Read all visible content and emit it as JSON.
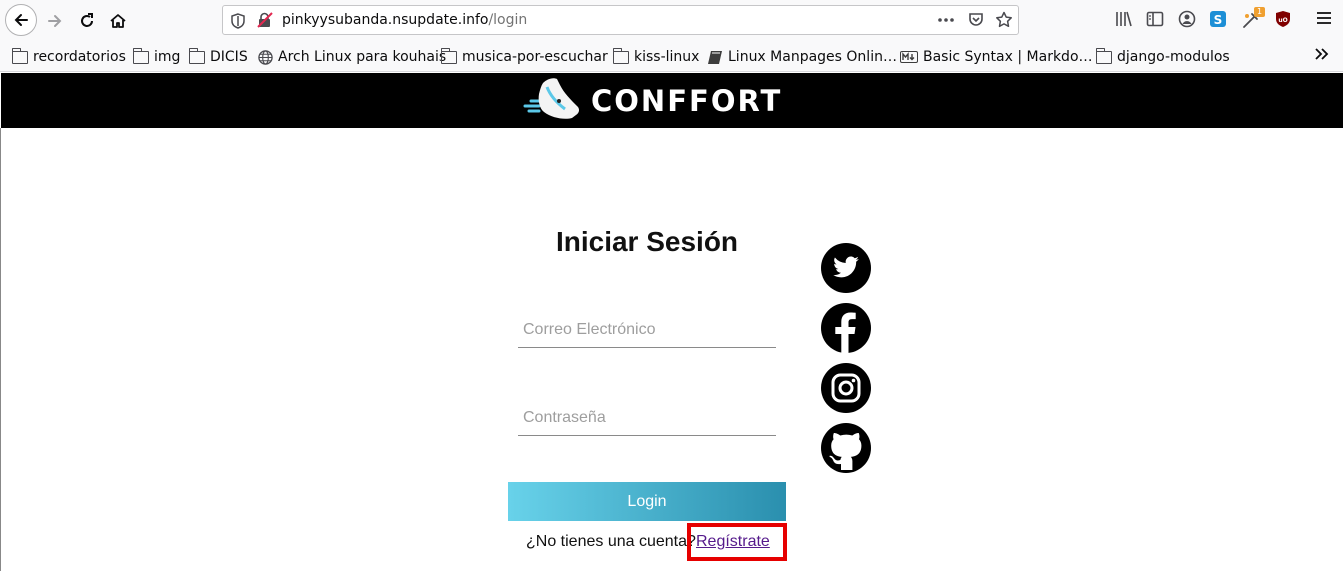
{
  "browser": {
    "url_host": "pinkyysubanda.nsupdate.info",
    "url_path": "/login",
    "extension_badge": "1"
  },
  "bookmarks": [
    {
      "label": "recordatorios",
      "icon": "folder-icon"
    },
    {
      "label": "img",
      "icon": "folder-icon"
    },
    {
      "label": "DICIS",
      "icon": "folder-icon"
    },
    {
      "label": "Arch Linux para kouhais",
      "icon": "globe-icon"
    },
    {
      "label": "musica-por-escuchar",
      "icon": "folder-icon"
    },
    {
      "label": "kiss-linux",
      "icon": "folder-icon"
    },
    {
      "label": "Linux Manpages Onlin…",
      "icon": "book-icon"
    },
    {
      "label": "Basic Syntax | Markdo…",
      "icon": "markdown-icon"
    },
    {
      "label": "django-modulos",
      "icon": "folder-icon"
    }
  ],
  "site": {
    "brand": "CONFFORT"
  },
  "login": {
    "title": "Iniciar Sesión",
    "email_placeholder": "Correo Electrónico",
    "password_placeholder": "Contraseña",
    "button_label": "Login",
    "signup_prompt": "¿No tienes una cuenta?",
    "signup_link": "Regístrate"
  },
  "social": [
    "twitter-icon",
    "facebook-icon",
    "instagram-icon",
    "github-icon"
  ],
  "colors": {
    "header_bg": "#000000",
    "button_gradient_start": "#68d2ea",
    "button_gradient_end": "#2a8fae",
    "highlight_box": "#e60000",
    "link": "#551a8b"
  }
}
